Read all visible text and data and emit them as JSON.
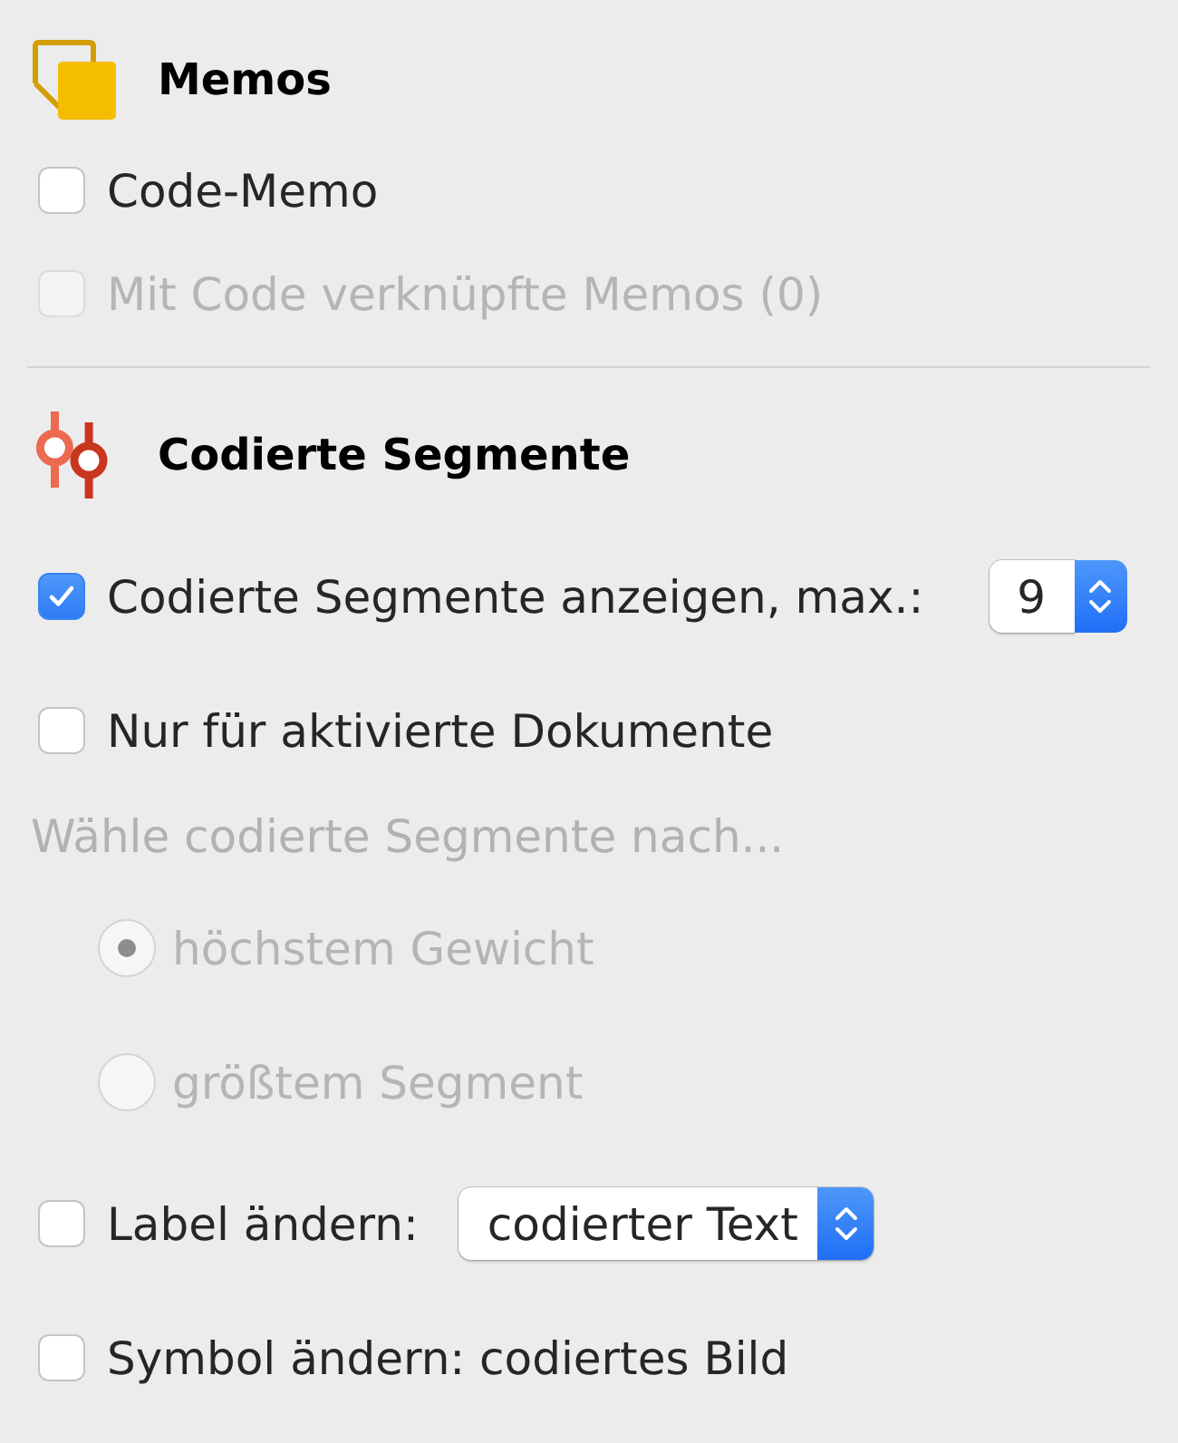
{
  "sections": [
    {
      "title": "Memos",
      "items": [
        {
          "kind": "checkbox",
          "label": "Code-Memo",
          "checked": false,
          "disabled": false
        },
        {
          "kind": "checkbox",
          "label": "Mit Code verknüpfte Memos (0)",
          "checked": false,
          "disabled": true
        }
      ]
    },
    {
      "title": "Codierte Segmente",
      "items": [
        {
          "kind": "checkbox_stepper",
          "label": "Codierte Segmente anzeigen, max.:",
          "checked": true,
          "disabled": false,
          "value": "9"
        },
        {
          "kind": "checkbox",
          "label": "Nur für aktivierte Dokumente",
          "checked": false,
          "disabled": false
        },
        {
          "kind": "caption",
          "label": "Wähle codierte Segmente nach...",
          "disabled": true
        },
        {
          "kind": "radio",
          "label": "höchstem Gewicht",
          "selected": true,
          "disabled": true
        },
        {
          "kind": "radio",
          "label": "größtem Segment",
          "selected": false,
          "disabled": true
        },
        {
          "kind": "checkbox_popup",
          "label": "Label ändern:",
          "checked": false,
          "disabled": false,
          "value": "codierter Text"
        },
        {
          "kind": "checkbox",
          "label": "Symbol ändern: codiertes Bild",
          "checked": false,
          "disabled": false
        }
      ]
    }
  ]
}
